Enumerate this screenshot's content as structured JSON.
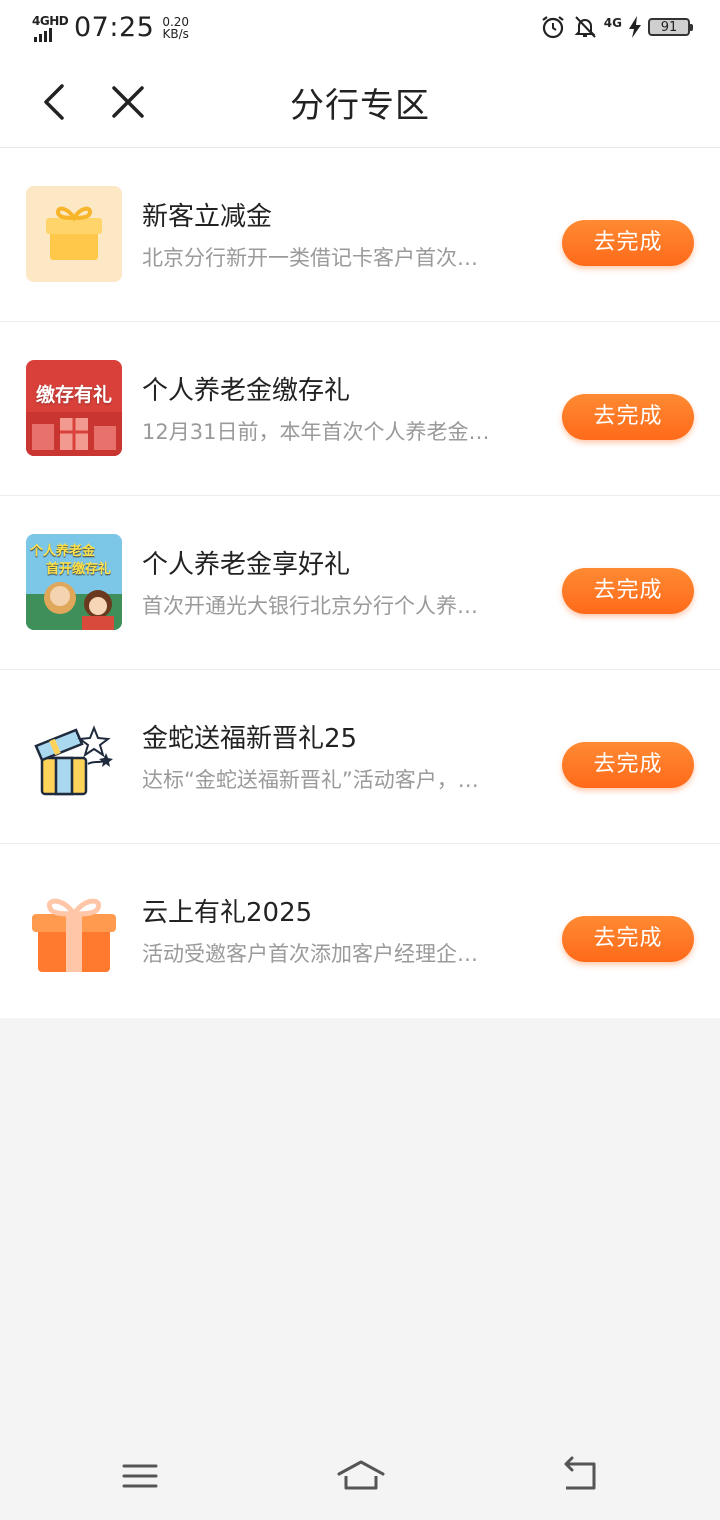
{
  "status_bar": {
    "network": "4GHD",
    "time": "07:25",
    "speed_value": "0.20",
    "speed_unit": "KB/s",
    "network2": "4G",
    "battery": "91"
  },
  "nav": {
    "title": "分行专区"
  },
  "items": [
    {
      "title": "新客立减金",
      "desc": "北京分行新开一类借记卡客户首次…",
      "button": "去完成",
      "icon": "gift-box-icon"
    },
    {
      "title": "个人养老金缴存礼",
      "desc": "12月31日前，本年首次个人养老金…",
      "button": "去完成",
      "thumb_text": "缴存有礼"
    },
    {
      "title": "个人养老金享好礼",
      "desc": "首次开通光大银行北京分行个人养…",
      "button": "去完成",
      "thumb_text_1": "个人养老金",
      "thumb_text_2": "首开缴存礼"
    },
    {
      "title": "金蛇送福新晋礼25",
      "desc": "达标“金蛇送福新晋礼”活动客户，…",
      "button": "去完成",
      "icon": "open-gift-icon"
    },
    {
      "title": "云上有礼2025",
      "desc": "活动受邀客户首次添加客户经理企…",
      "button": "去完成",
      "icon": "orange-gift-icon"
    }
  ],
  "colors": {
    "accent": "#ff6a1a",
    "background": "#f4f4f4"
  }
}
